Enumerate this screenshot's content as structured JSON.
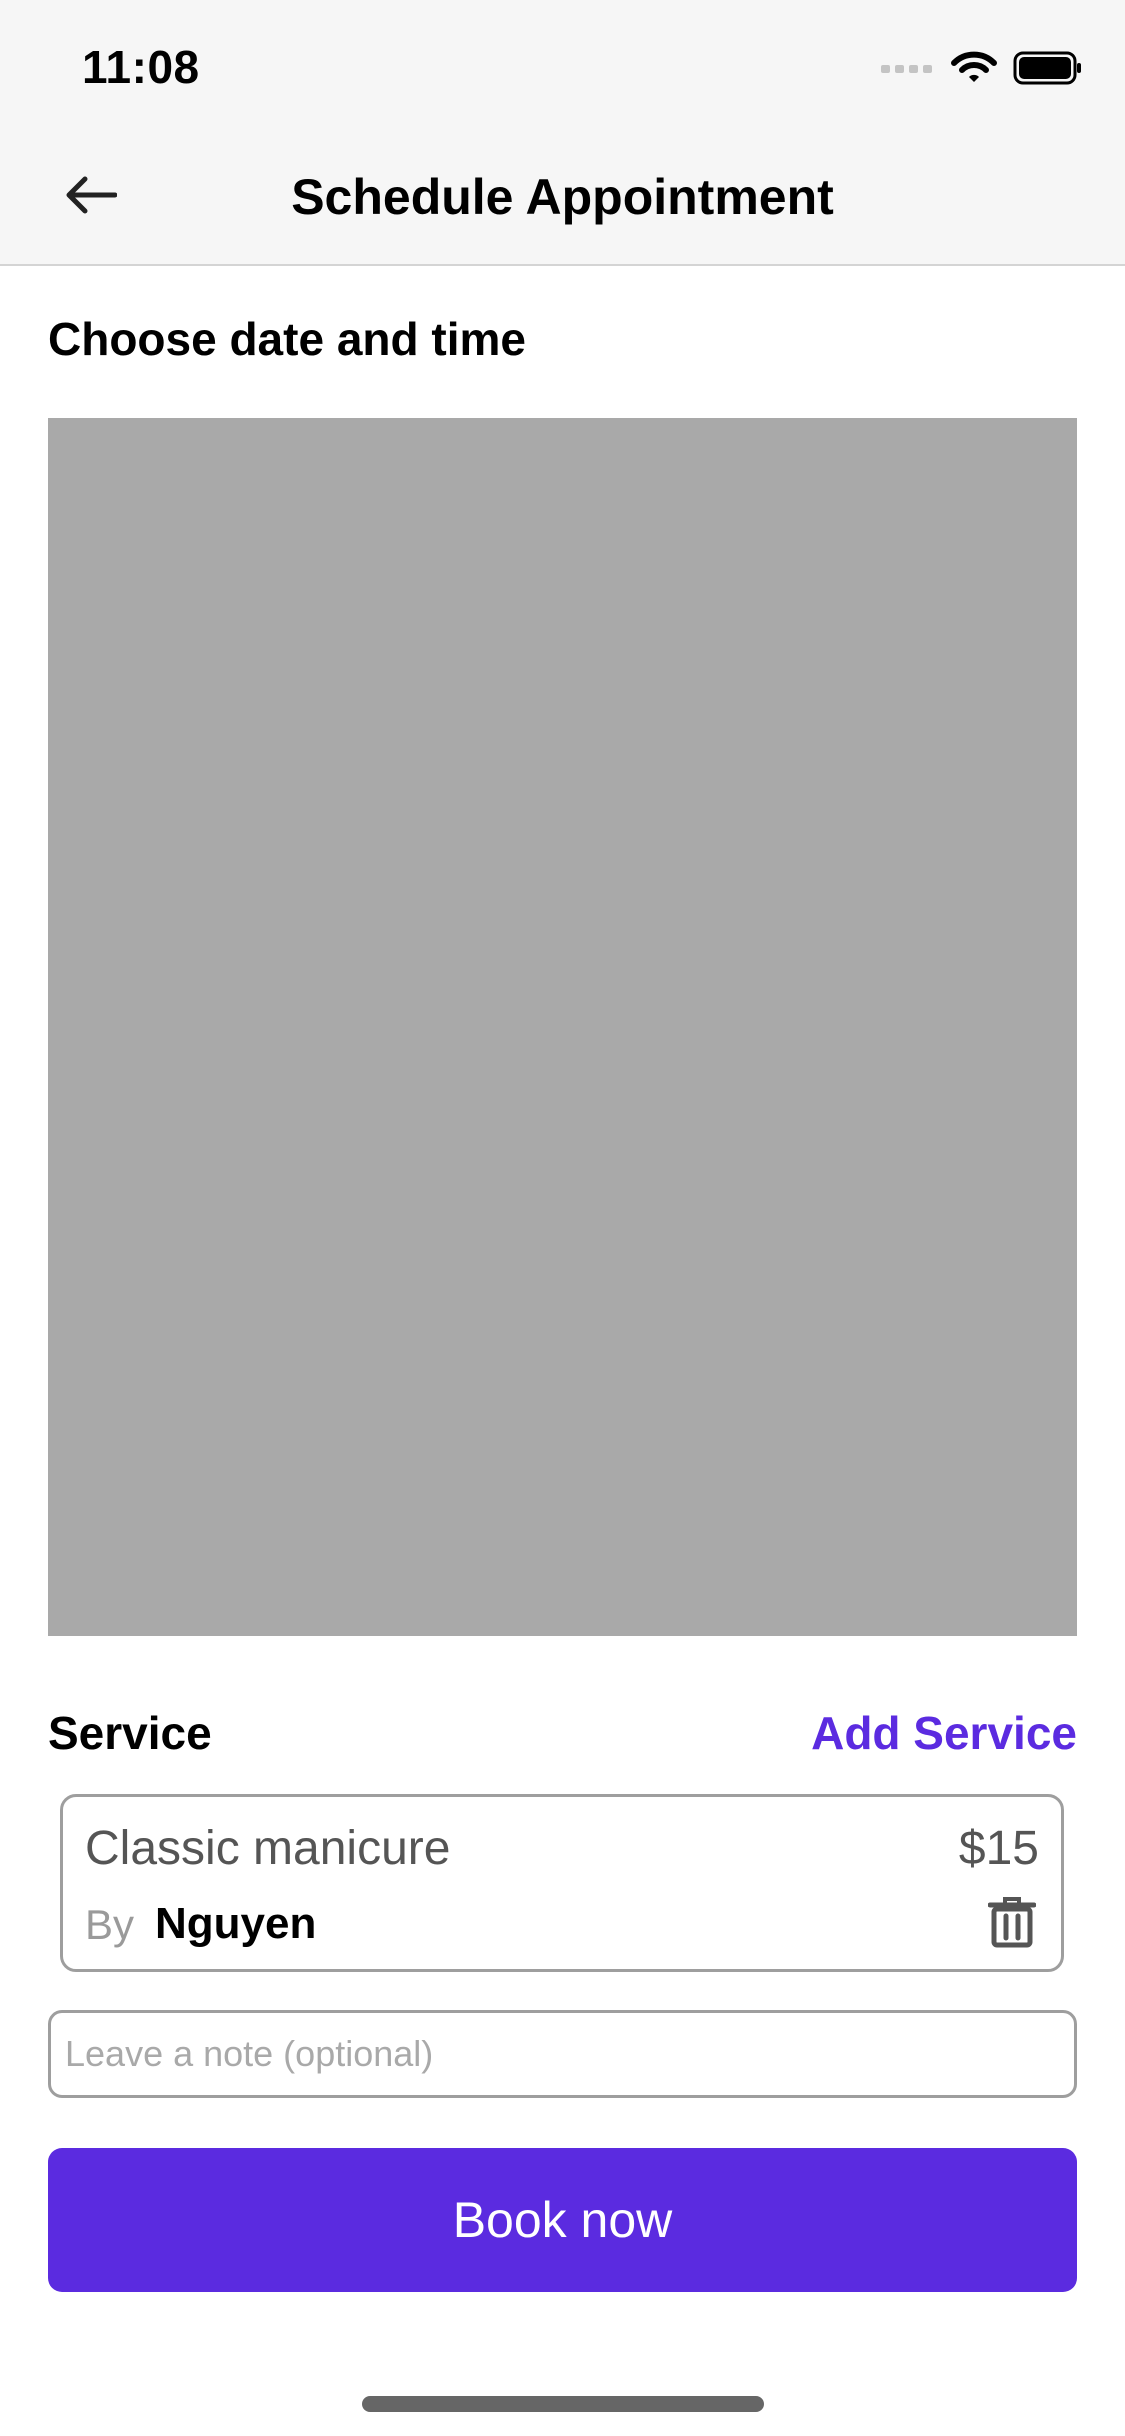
{
  "status_bar": {
    "time": "11:08",
    "icons": [
      "cellular-signal-icon",
      "wifi-icon",
      "battery-icon"
    ]
  },
  "nav": {
    "title": "Schedule Appointment",
    "back_icon": "back-arrow-icon"
  },
  "datetime": {
    "heading": "Choose date and time"
  },
  "service": {
    "heading": "Service",
    "add_label": "Add Service",
    "item": {
      "name": "Classic manicure",
      "price": "$15",
      "by_label": "By",
      "staff": "Nguyen",
      "delete_icon": "trash-icon"
    }
  },
  "note": {
    "placeholder": "Leave a note (optional)",
    "value": ""
  },
  "actions": {
    "book_label": "Book now"
  },
  "colors": {
    "accent": "#5b2be0",
    "placeholder_block": "#a9a9a9",
    "bar_background": "#f6f6f6"
  }
}
